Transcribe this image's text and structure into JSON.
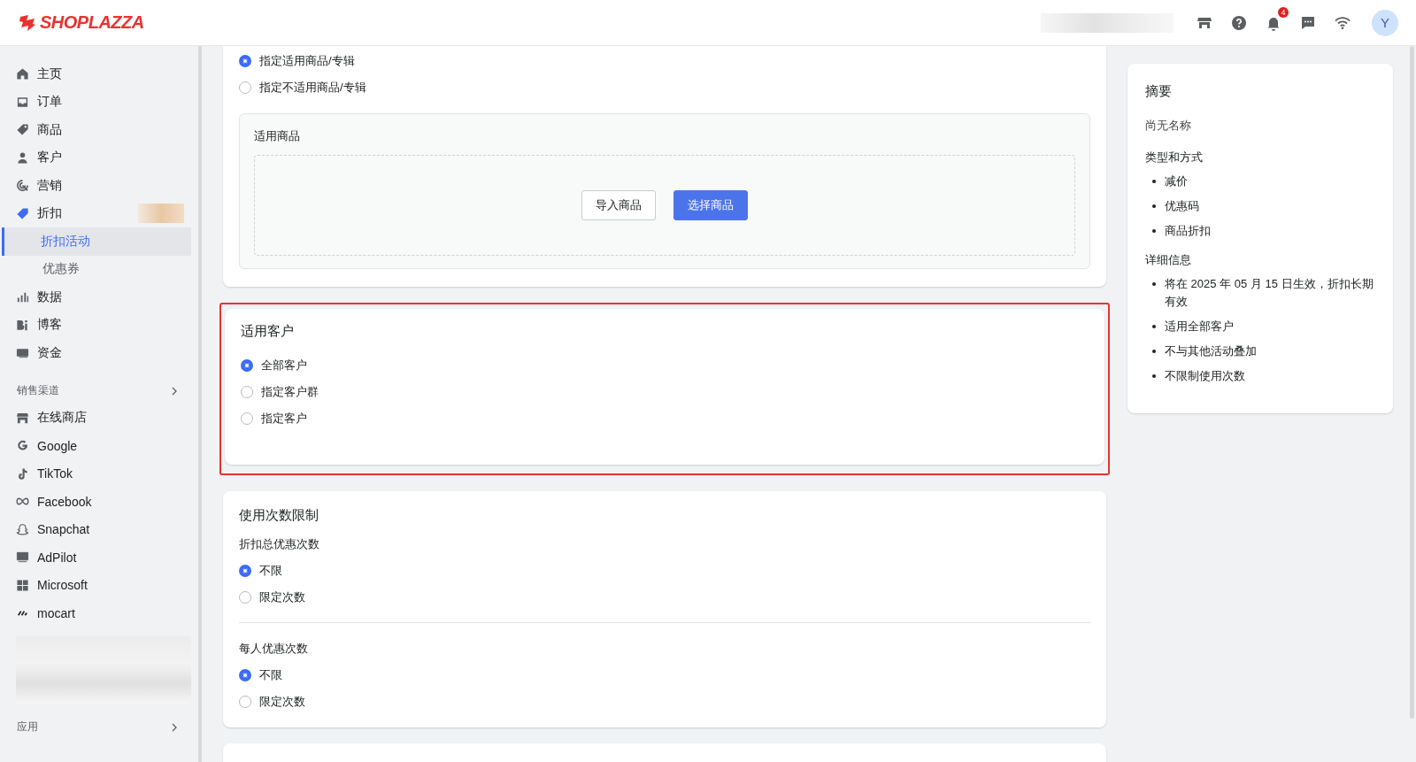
{
  "header": {
    "logo": "SHOPLAZZA",
    "notification_count": "4",
    "avatar": "Y"
  },
  "sidebar": {
    "items": [
      {
        "label": "主页",
        "selected": false
      },
      {
        "label": "订单",
        "selected": false
      },
      {
        "label": "商品",
        "selected": false
      },
      {
        "label": "客户",
        "selected": false
      },
      {
        "label": "营销",
        "selected": false
      },
      {
        "label": "折扣",
        "selected": false,
        "children": [
          {
            "label": "折扣活动",
            "selected": true
          },
          {
            "label": "优惠券",
            "selected": false
          }
        ]
      },
      {
        "label": "数据",
        "selected": false
      },
      {
        "label": "博客",
        "selected": false
      },
      {
        "label": "资金",
        "selected": false
      }
    ],
    "channels_heading": "销售渠道",
    "channels": [
      {
        "label": "在线商店"
      },
      {
        "label": "Google"
      },
      {
        "label": "TikTok"
      },
      {
        "label": "Facebook"
      },
      {
        "label": "Snapchat"
      },
      {
        "label": "AdPilot"
      },
      {
        "label": "Microsoft"
      },
      {
        "label": "mocart"
      }
    ],
    "apps_heading": "应用"
  },
  "products_section": {
    "options": [
      {
        "label": "指定适用商品/专辑",
        "selected": true
      },
      {
        "label": "指定不适用商品/专辑",
        "selected": false
      }
    ],
    "panel_title": "适用商品",
    "buttons": [
      {
        "label": "导入商品",
        "kind": "secondary"
      },
      {
        "label": "选择商品",
        "kind": "primary"
      }
    ]
  },
  "customers_section": {
    "title": "适用客户",
    "highlighted": true,
    "options": [
      {
        "label": "全部客户",
        "selected": true
      },
      {
        "label": "指定客户群",
        "selected": false
      },
      {
        "label": "指定客户",
        "selected": false
      }
    ]
  },
  "usage_section": {
    "title": "使用次数限制",
    "groups": [
      {
        "label": "折扣总优惠次数",
        "options": [
          {
            "label": "不限",
            "selected": true
          },
          {
            "label": "限定次数",
            "selected": false
          }
        ]
      },
      {
        "label": "每人优惠次数",
        "options": [
          {
            "label": "不限",
            "selected": true
          },
          {
            "label": "限定次数",
            "selected": false
          }
        ]
      }
    ]
  },
  "summary": {
    "title": "摘要",
    "name": "尚无名称",
    "sections": [
      {
        "heading": "类型和方式",
        "items": [
          "减价",
          "优惠码",
          "商品折扣"
        ]
      },
      {
        "heading": "详细信息",
        "items": [
          "将在 2025 年 05 月 15 日生效，折扣长期有效",
          "适用全部客户",
          "不与其他活动叠加",
          "不限制使用次数"
        ]
      }
    ]
  }
}
